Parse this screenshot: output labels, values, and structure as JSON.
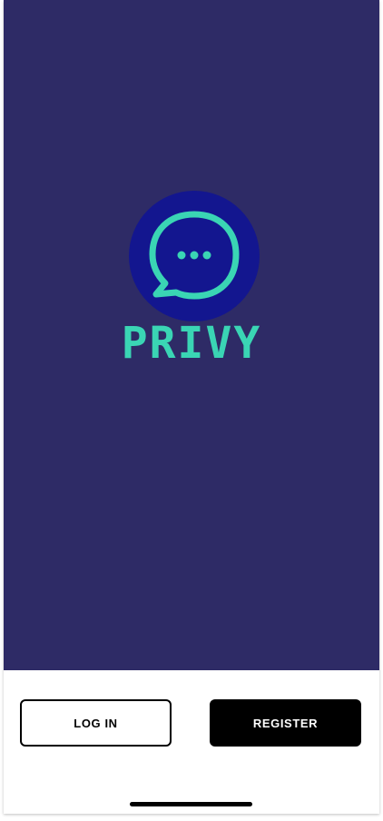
{
  "app": {
    "brand_name": "PRIVY",
    "logo_icon": "chat-bubble-ellipsis-icon"
  },
  "actions": {
    "login_label": "LOG IN",
    "register_label": "REGISTER"
  },
  "colors": {
    "hero_background": "#2e2b66",
    "logo_circle": "#13168f",
    "accent": "#3ad5b4",
    "button_dark": "#000000",
    "button_light": "#ffffff"
  }
}
